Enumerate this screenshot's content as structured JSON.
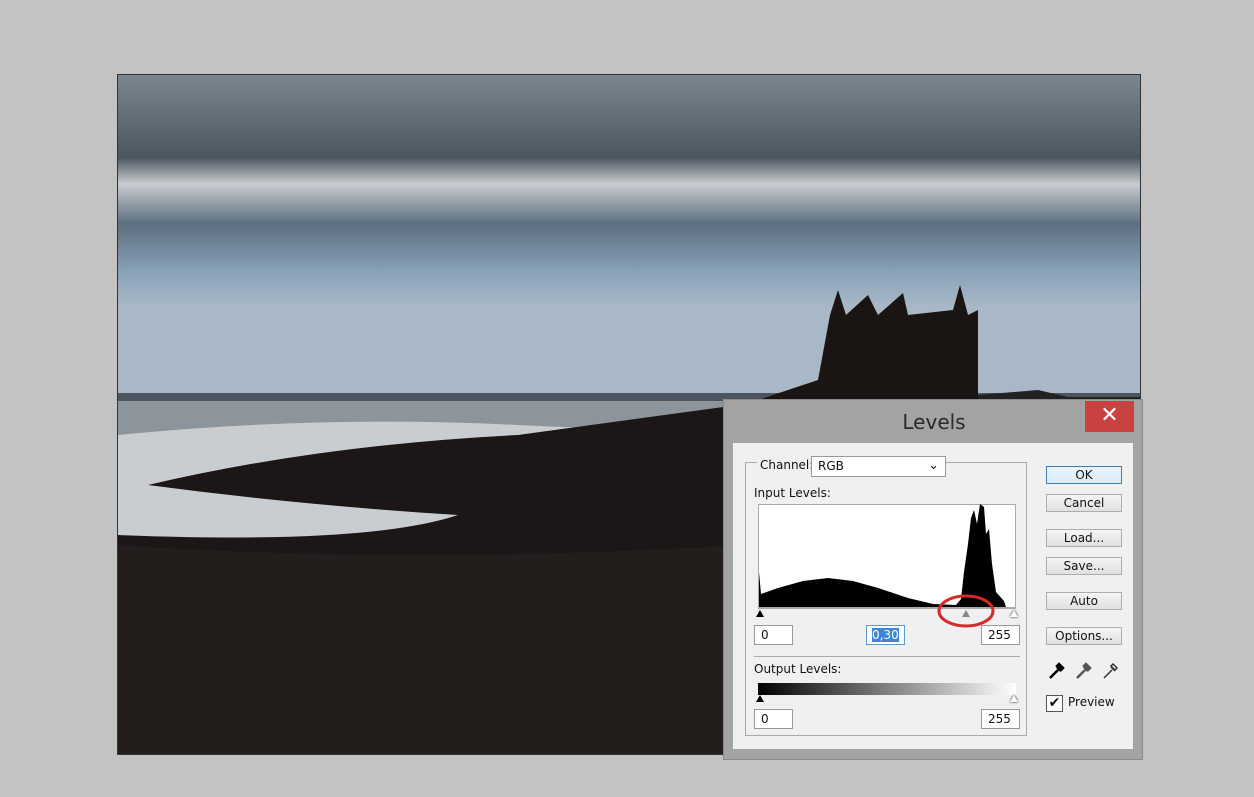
{
  "dialog": {
    "title": "Levels",
    "close_icon": "close-icon",
    "channel_label": "Channel:",
    "channel_value": "RGB",
    "input_levels_label": "Input Levels:",
    "input_black": "0",
    "input_gamma": "0,30",
    "input_white": "255",
    "output_levels_label": "Output Levels:",
    "output_black": "0",
    "output_white": "255",
    "buttons": {
      "ok": "OK",
      "cancel": "Cancel",
      "load": "Load...",
      "save": "Save...",
      "auto": "Auto",
      "options": "Options..."
    },
    "preview_label": "Preview",
    "preview_checked": true,
    "eyedroppers": [
      "black-point-eyedropper-icon",
      "gray-point-eyedropper-icon",
      "white-point-eyedropper-icon"
    ],
    "annotation_color": "#d42a2a",
    "close_color": "#c9423f"
  }
}
